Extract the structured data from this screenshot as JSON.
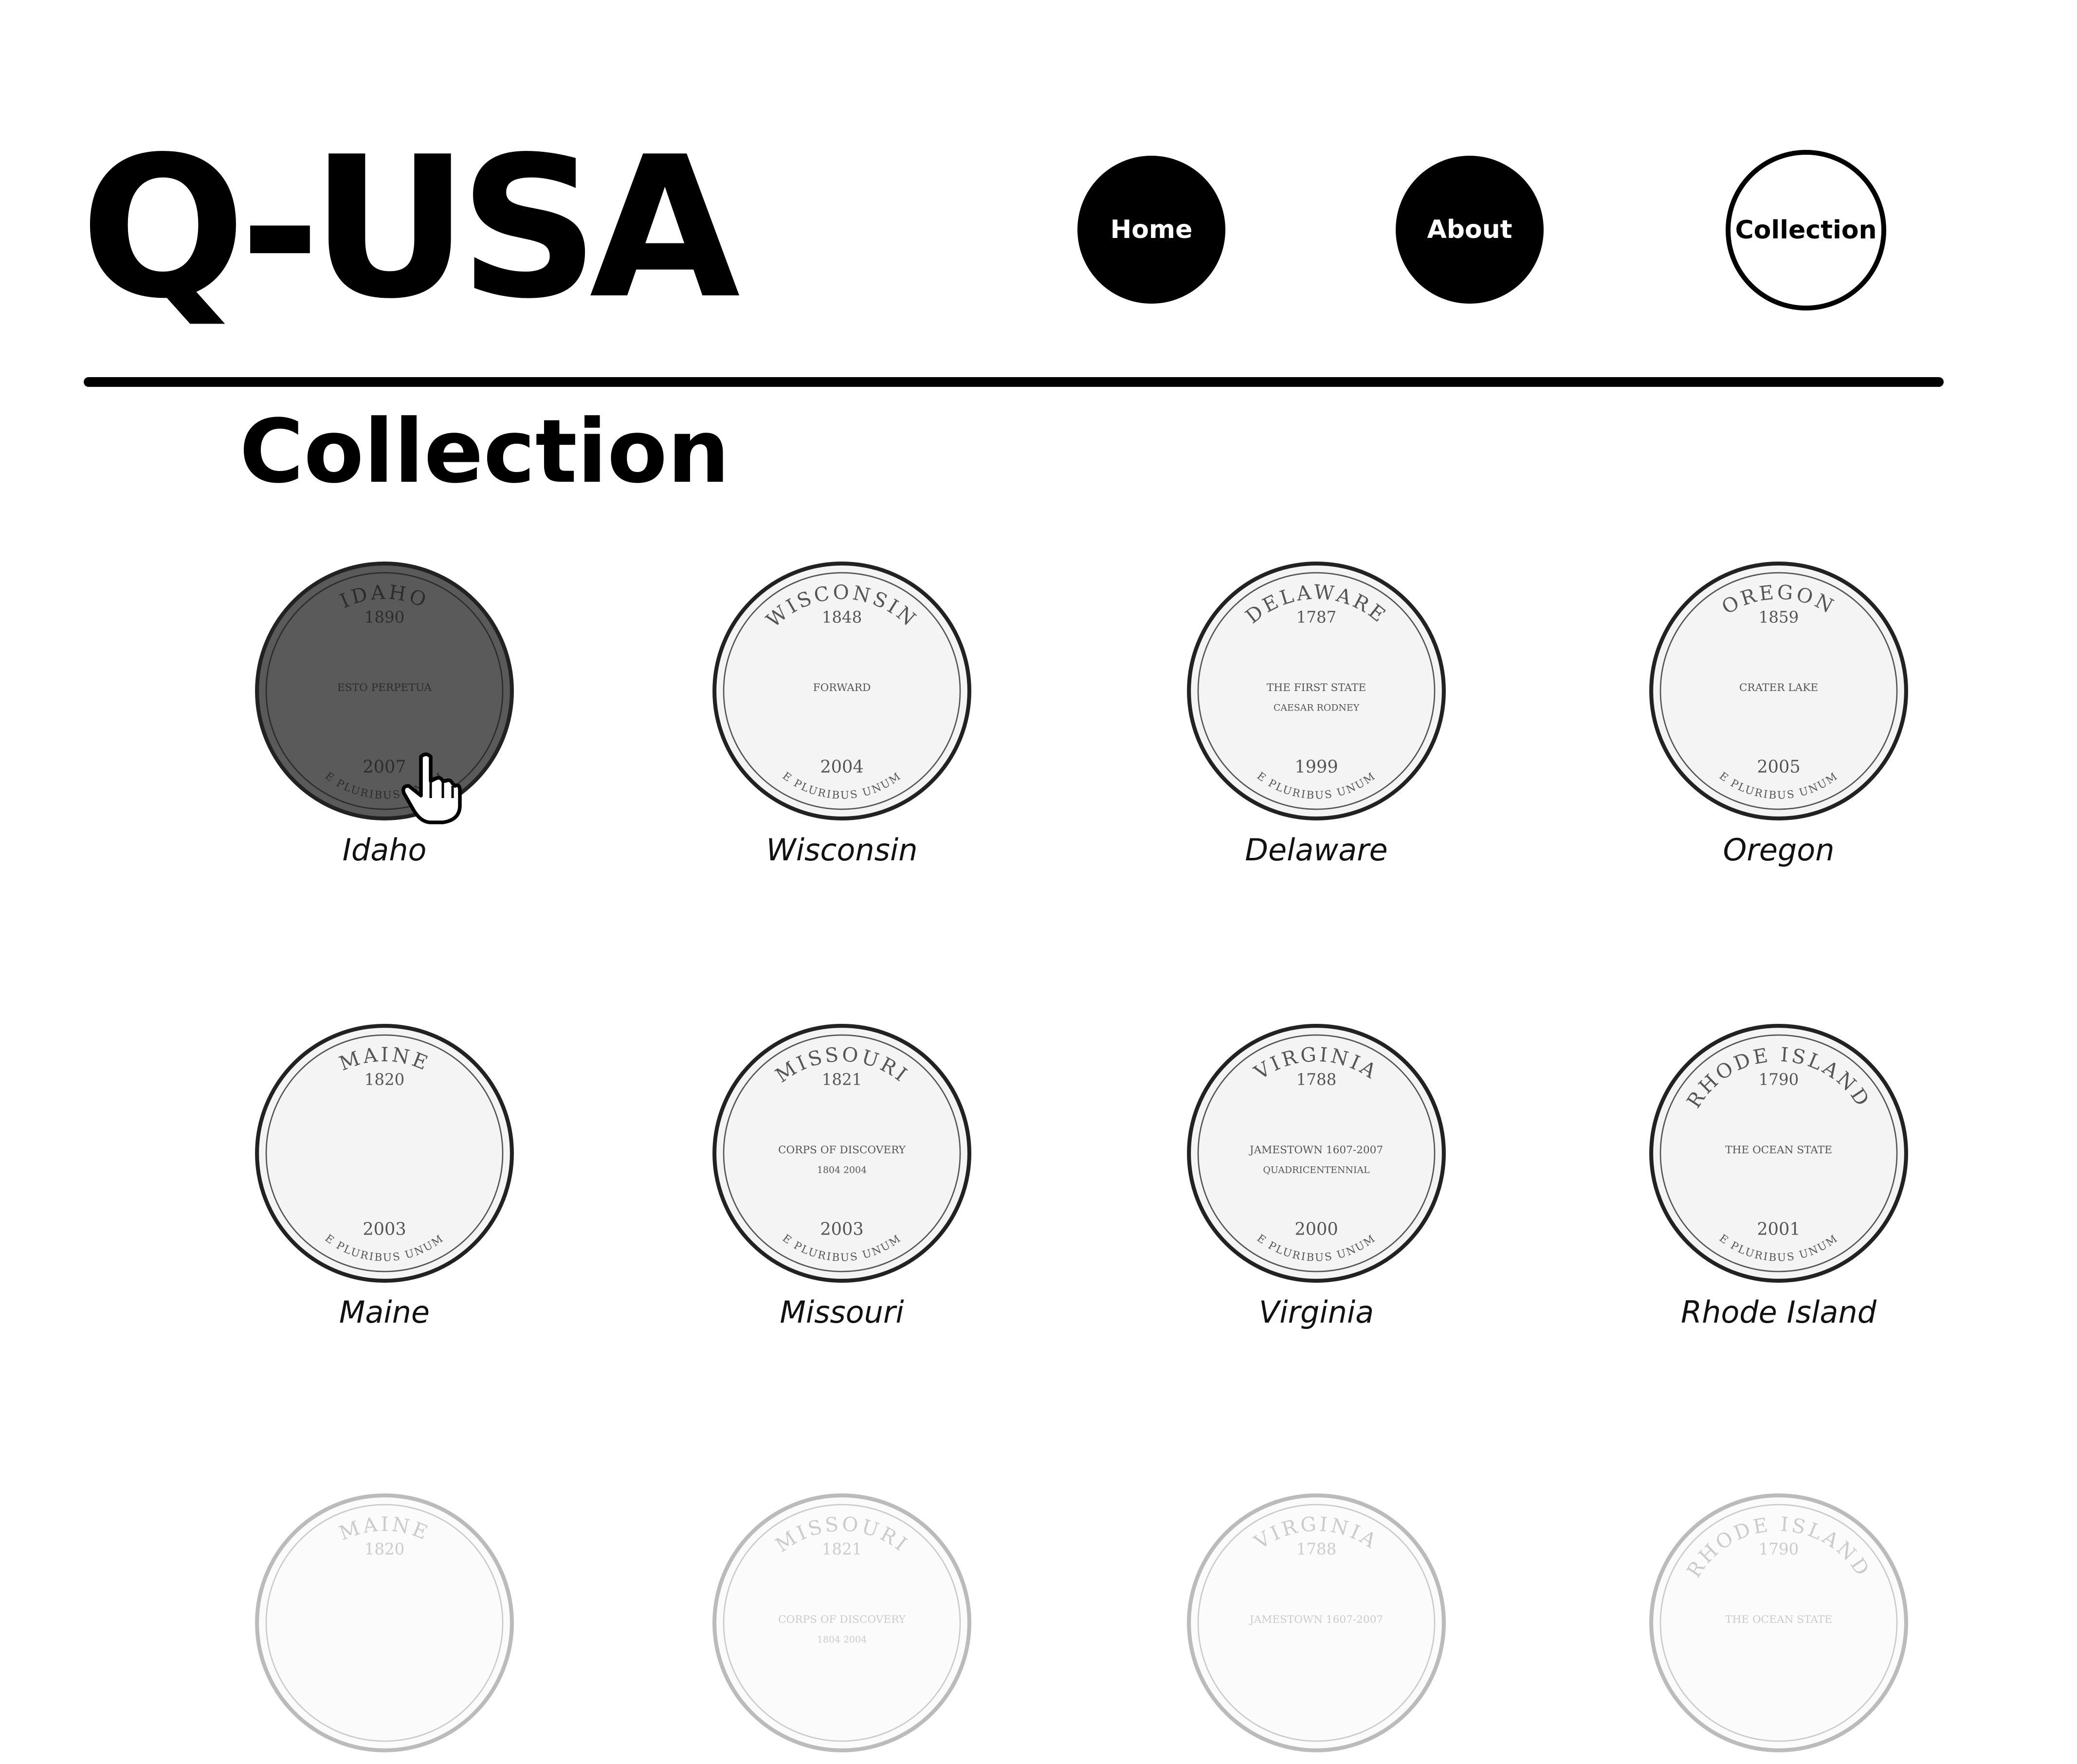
{
  "header": {
    "logo": "Q-USA"
  },
  "nav": {
    "home": "Home",
    "about": "About",
    "collection": "Collection"
  },
  "page": {
    "title": "Collection"
  },
  "coins": [
    {
      "label": "Idaho",
      "top_text": "IDAHO",
      "year_founded": "1890",
      "motto": "ESTO PERPETUA",
      "year_minted": "2007",
      "bottom_text": "E PLURIBUS UNUM",
      "hovered": true
    },
    {
      "label": "Wisconsin",
      "top_text": "WISCONSIN",
      "year_founded": "1848",
      "motto": "FORWARD",
      "year_minted": "2004",
      "bottom_text": "E PLURIBUS UNUM"
    },
    {
      "label": "Delaware",
      "top_text": "DELAWARE",
      "year_founded": "1787",
      "motto": "THE FIRST STATE",
      "extra": "CAESAR RODNEY",
      "year_minted": "1999",
      "bottom_text": "E PLURIBUS UNUM"
    },
    {
      "label": "Oregon",
      "top_text": "OREGON",
      "year_founded": "1859",
      "motto": "CRATER LAKE",
      "year_minted": "2005",
      "bottom_text": "E PLURIBUS UNUM"
    },
    {
      "label": "Maine",
      "top_text": "MAINE",
      "year_founded": "1820",
      "year_minted": "2003",
      "bottom_text": "E PLURIBUS UNUM"
    },
    {
      "label": "Missouri",
      "top_text": "MISSOURI",
      "year_founded": "1821",
      "motto": "CORPS OF DISCOVERY",
      "extra": "1804 2004",
      "year_minted": "2003",
      "bottom_text": "E PLURIBUS UNUM"
    },
    {
      "label": "Virginia",
      "top_text": "VIRGINIA",
      "year_founded": "1788",
      "motto": "JAMESTOWN 1607-2007",
      "extra": "QUADRICENTENNIAL",
      "year_minted": "2000",
      "bottom_text": "E PLURIBUS UNUM"
    },
    {
      "label": "Rhode Island",
      "top_text": "RHODE ISLAND",
      "year_founded": "1790",
      "motto": "THE OCEAN STATE",
      "year_minted": "2001",
      "bottom_text": "E PLURIBUS UNUM"
    },
    {
      "label": "",
      "top_text": "MAINE",
      "year_founded": "1820",
      "faded": true
    },
    {
      "label": "",
      "top_text": "MISSOURI",
      "year_founded": "1821",
      "motto": "CORPS OF DISCOVERY",
      "extra": "1804 2004",
      "faded": true
    },
    {
      "label": "",
      "top_text": "VIRGINIA",
      "year_founded": "1788",
      "motto": "JAMESTOWN 1607-2007",
      "faded": true
    },
    {
      "label": "",
      "top_text": "RHODE ISLAND",
      "year_founded": "1790",
      "motto": "THE OCEAN STATE",
      "faded": true
    }
  ],
  "icons": {
    "cursor": "hand-pointer-icon"
  },
  "colors": {
    "primary": "#000000",
    "background": "#ffffff",
    "hover_coin": "#5a5a5a"
  }
}
